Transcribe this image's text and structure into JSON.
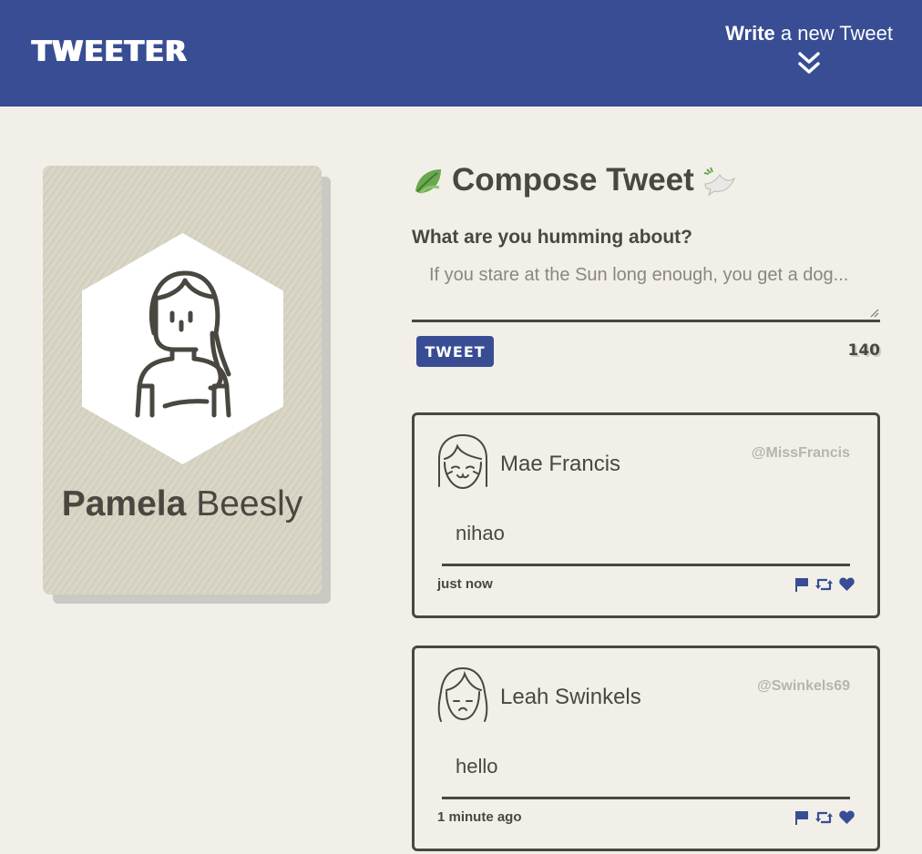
{
  "nav": {
    "brand": "TWEETER",
    "write_bold": "Write",
    "write_rest": " a new Tweet"
  },
  "profile": {
    "first_name": "Pamela",
    "last_name": "Beesly"
  },
  "compose": {
    "title": "Compose Tweet",
    "prompt": "What are you humming about?",
    "placeholder": "If you stare at the Sun long enough, you get a dog...",
    "button_label": "TWEET",
    "counter": "140"
  },
  "tweets": [
    {
      "name": "Mae Francis",
      "handle": "@MissFrancis",
      "text": "nihao",
      "time": "just now"
    },
    {
      "name": "Leah Swinkels",
      "handle": "@Swinkels69",
      "text": "hello",
      "time": "1 minute ago"
    }
  ],
  "icons": {
    "compose_left": "leaf-icon",
    "compose_right": "dove-icon",
    "nav_arrow": "double-chevron-down-icon",
    "actions": [
      "flag-icon",
      "retweet-icon",
      "heart-icon"
    ]
  },
  "colors": {
    "accent": "#384d93",
    "background": "#f2efe9",
    "text": "#4a4740",
    "card": "#d7d4c3",
    "handle": "#b7b4ad"
  }
}
